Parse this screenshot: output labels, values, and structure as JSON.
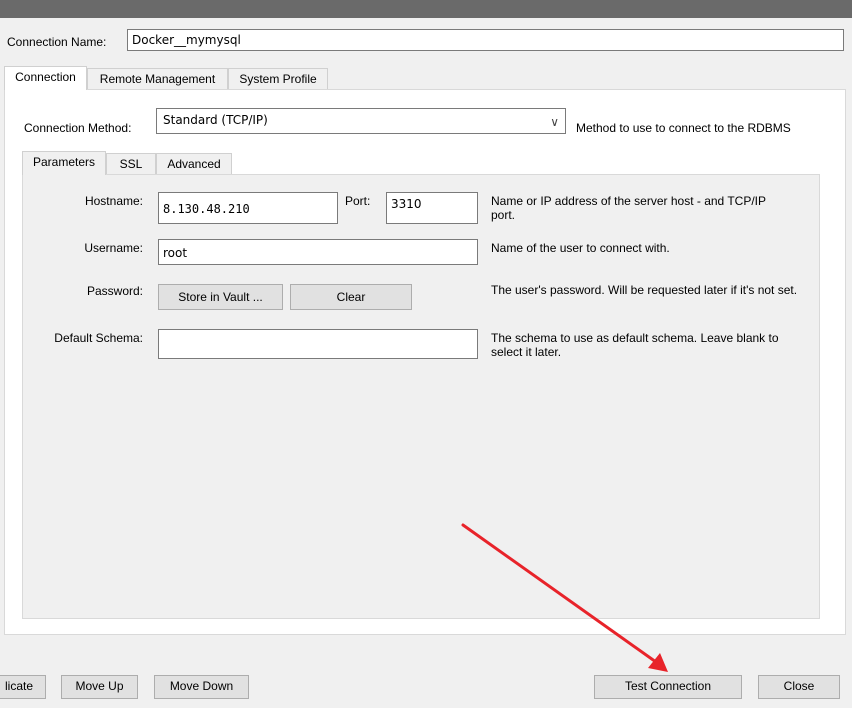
{
  "connection_name": {
    "label": "Connection Name:",
    "value": "Docker__mymysql"
  },
  "tabs": [
    "Connection",
    "Remote Management",
    "System Profile"
  ],
  "connection_method": {
    "label": "Connection Method:",
    "value": "Standard (TCP/IP)",
    "description": "Method to use to connect to the RDBMS"
  },
  "subtabs": [
    "Parameters",
    "SSL",
    "Advanced"
  ],
  "params": {
    "hostname": {
      "label": "Hostname:",
      "value": "8.130.48.210",
      "description": "Name or IP address of the server host - and TCP/IP port."
    },
    "port": {
      "label": "Port:",
      "value": "3310"
    },
    "username": {
      "label": "Username:",
      "value": "root",
      "description": "Name of the user to connect with."
    },
    "password": {
      "label": "Password:",
      "store_button": "Store in Vault ...",
      "clear_button": "Clear",
      "description": "The user's password. Will be requested later if it's not set."
    },
    "schema": {
      "label": "Default Schema:",
      "value": "",
      "description": "The schema to use as default schema. Leave blank to select it later."
    }
  },
  "footer": {
    "duplicate": "licate",
    "move_up": "Move Up",
    "move_down": "Move Down",
    "test_connection": "Test Connection",
    "close": "Close"
  },
  "colors": {
    "arrow": "#e8232a",
    "titlebar": "#6a6a6a"
  }
}
